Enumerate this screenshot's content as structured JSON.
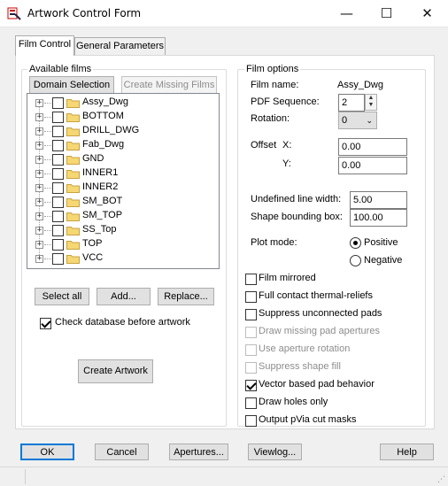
{
  "window": {
    "title": "Artwork Control Form",
    "minimize_glyph": "—",
    "maximize_glyph": "☐",
    "close_glyph": "✕",
    "icon": "pcb-app-icon"
  },
  "tabs": [
    {
      "label": "Film Control",
      "active": true
    },
    {
      "label": "General Parameters",
      "active": false
    }
  ],
  "available_films": {
    "group_label": "Available films",
    "domain_selection": "Domain Selection",
    "create_missing": "Create Missing Films",
    "films": [
      "Assy_Dwg",
      "BOTTOM",
      "DRILL_DWG",
      "Fab_Dwg",
      "GND",
      "INNER1",
      "INNER2",
      "SM_BOT",
      "SM_TOP",
      "SS_Top",
      "TOP",
      "VCC"
    ],
    "select_all": "Select all",
    "add": "Add...",
    "replace": "Replace...",
    "check_db_label": "Check database before artwork",
    "check_db_checked": true,
    "create_artwork": "Create Artwork"
  },
  "film_options": {
    "group_label": "Film options",
    "film_name_label": "Film name:",
    "film_name_value": "Assy_Dwg",
    "pdf_seq_label": "PDF Sequence:",
    "pdf_seq_value": "2",
    "rotation_label": "Rotation:",
    "rotation_value": "0",
    "offset_label": "Offset",
    "x_label": "X:",
    "x_value": "0.00",
    "y_label": "Y:",
    "y_value": "0.00",
    "undef_line_label": "Undefined line width:",
    "undef_line_value": "5.00",
    "shape_box_label": "Shape bounding box:",
    "shape_box_value": "100.00",
    "plot_mode_label": "Plot mode:",
    "positive_label": "Positive",
    "negative_label": "Negative",
    "plot_mode": "Positive",
    "checkboxes": [
      {
        "label": "Film mirrored",
        "checked": false,
        "enabled": true
      },
      {
        "label": "Full contact thermal-reliefs",
        "checked": false,
        "enabled": true
      },
      {
        "label": "Suppress unconnected pads",
        "checked": false,
        "enabled": true
      },
      {
        "label": "Draw missing pad apertures",
        "checked": false,
        "enabled": false
      },
      {
        "label": "Use aperture rotation",
        "checked": false,
        "enabled": false
      },
      {
        "label": "Suppress shape fill",
        "checked": false,
        "enabled": false
      },
      {
        "label": "Vector based pad behavior",
        "checked": true,
        "enabled": true
      },
      {
        "label": "Draw holes only",
        "checked": false,
        "enabled": true
      },
      {
        "label": "Output pVia cut masks",
        "checked": false,
        "enabled": true
      }
    ]
  },
  "footer": {
    "ok": "OK",
    "cancel": "Cancel",
    "apertures": "Apertures...",
    "viewlog": "Viewlog...",
    "help": "Help"
  },
  "colors": {
    "accent": "#0078d7",
    "folder": "#f5d774"
  }
}
